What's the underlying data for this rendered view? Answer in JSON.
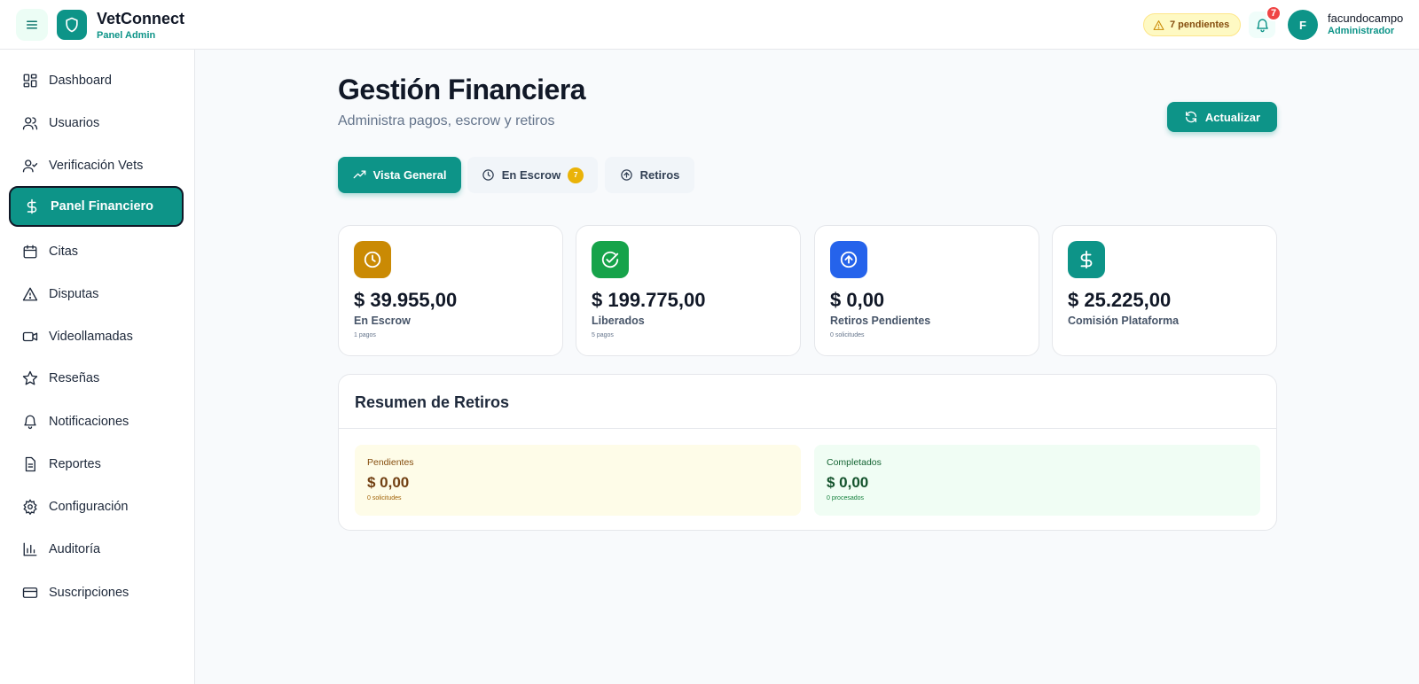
{
  "header": {
    "brand_title": "VetConnect",
    "brand_subtitle": "Panel Admin",
    "pending_label": "7 pendientes",
    "notification_count": "7",
    "avatar_initial": "F",
    "user_name": "facundocampo",
    "user_role": "Administrador"
  },
  "sidebar": {
    "items": [
      {
        "label": "Dashboard",
        "icon": "dashboard-icon"
      },
      {
        "label": "Usuarios",
        "icon": "users-icon"
      },
      {
        "label": "Verificación Vets",
        "icon": "user-check-icon"
      },
      {
        "label": "Panel Financiero",
        "icon": "dollar-icon",
        "active": true
      },
      {
        "label": "Citas",
        "icon": "calendar-icon"
      },
      {
        "label": "Disputas",
        "icon": "alert-triangle-icon"
      },
      {
        "label": "Videollamadas",
        "icon": "video-icon"
      },
      {
        "label": "Reseñas",
        "icon": "star-icon"
      },
      {
        "label": "Notificaciones",
        "icon": "bell-icon"
      },
      {
        "label": "Reportes",
        "icon": "file-text-icon"
      },
      {
        "label": "Configuración",
        "icon": "gear-icon"
      },
      {
        "label": "Auditoría",
        "icon": "bar-chart-icon"
      },
      {
        "label": "Suscripciones",
        "icon": "credit-card-icon"
      }
    ]
  },
  "page": {
    "title": "Gestión Financiera",
    "subtitle": "Administra pagos, escrow y retiros",
    "refresh_label": "Actualizar"
  },
  "tabs": [
    {
      "label": "Vista General",
      "active": true
    },
    {
      "label": "En Escrow",
      "badge": "7"
    },
    {
      "label": "Retiros"
    }
  ],
  "stats": [
    {
      "value": "$ 39.955,00",
      "label": "En Escrow",
      "sub": "1 pagos",
      "color": "#ca8a04",
      "icon": "clock-icon"
    },
    {
      "value": "$ 199.775,00",
      "label": "Liberados",
      "sub": "5 pagos",
      "color": "#16a34a",
      "icon": "check-circle-icon"
    },
    {
      "value": "$ 0,00",
      "label": "Retiros Pendientes",
      "sub": "0 solicitudes",
      "color": "#2563eb",
      "icon": "arrow-up-circle-icon"
    },
    {
      "value": "$ 25.225,00",
      "label": "Comisión Plataforma",
      "sub": "",
      "color": "#0d9488",
      "icon": "dollar-icon"
    }
  ],
  "resumen": {
    "title": "Resumen de Retiros",
    "pendientes": {
      "label": "Pendientes",
      "value": "$ 0,00",
      "note": "0 solicitudes"
    },
    "completados": {
      "label": "Completados",
      "value": "$ 0,00",
      "note": "0 procesados"
    }
  },
  "colors": {
    "accent": "#0d9488",
    "pending_bg": "#fefce8",
    "completed_bg": "#f0fdf4"
  }
}
